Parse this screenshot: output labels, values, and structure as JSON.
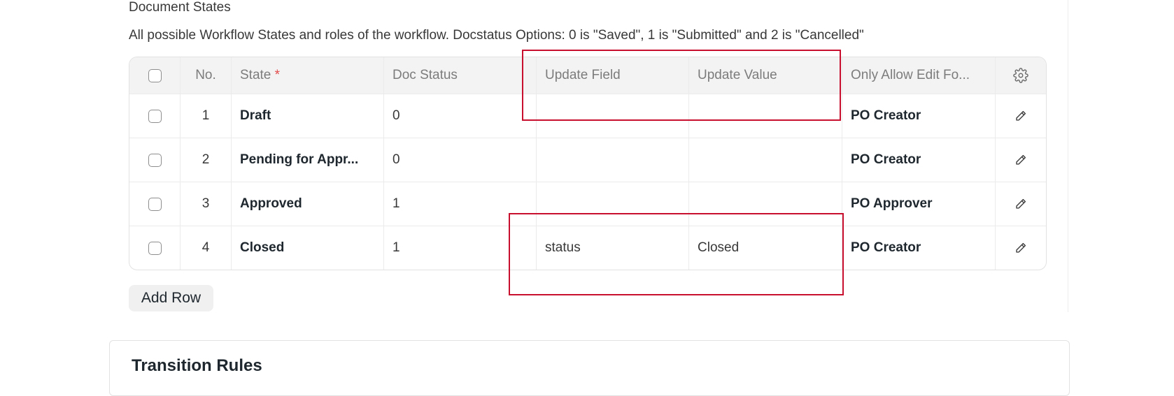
{
  "section": {
    "label": "Document States",
    "description": "All possible Workflow States and roles of the workflow. Docstatus Options: 0 is \"Saved\", 1 is \"Submitted\" and 2 is \"Cancelled\""
  },
  "table": {
    "columns": {
      "no": "No.",
      "state": "State",
      "state_required_mark": "*",
      "doc_status": "Doc Status",
      "update_field": "Update Field",
      "update_value": "Update Value",
      "only_allow_edit_for": "Only Allow Edit Fo..."
    },
    "rows": [
      {
        "no": "1",
        "state": "Draft",
        "doc_status": "0",
        "update_field": "",
        "update_value": "",
        "only_allow_edit_for": "PO Creator"
      },
      {
        "no": "2",
        "state": "Pending for Appr...",
        "doc_status": "0",
        "update_field": "",
        "update_value": "",
        "only_allow_edit_for": "PO Creator"
      },
      {
        "no": "3",
        "state": "Approved",
        "doc_status": "1",
        "update_field": "",
        "update_value": "",
        "only_allow_edit_for": "PO Approver"
      },
      {
        "no": "4",
        "state": "Closed",
        "doc_status": "1",
        "update_field": "status",
        "update_value": "Closed",
        "only_allow_edit_for": "PO Creator"
      }
    ]
  },
  "add_row_label": "Add Row",
  "transition_rules": {
    "title": "Transition Rules"
  },
  "icons": {
    "settings": "gear-icon",
    "edit": "pencil-icon",
    "checkbox": "checkbox-icon"
  },
  "colors": {
    "highlight": "#c8102e",
    "required": "#e24c4c"
  }
}
